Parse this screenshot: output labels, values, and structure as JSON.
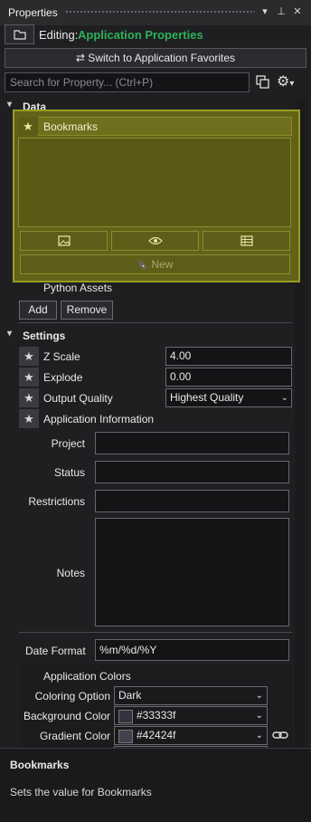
{
  "titlebar": {
    "title": "Properties",
    "pin_glyph": "⊥",
    "close_glyph": "✕",
    "dropdown_glyph": "▾"
  },
  "editing": {
    "label": "Editing:",
    "value": "Application Properties"
  },
  "switch_button": {
    "label": "⇄ Switch to Application Favorites"
  },
  "search": {
    "placeholder": "Search for Property... (Ctrl+P)"
  },
  "toolbar": {
    "gear_glyph": "⚙",
    "gear_dropdown": "▾"
  },
  "sections": {
    "data": {
      "label": "Data",
      "chevron": "▾"
    },
    "settings": {
      "label": "Settings",
      "chevron": "▾"
    }
  },
  "bookmarks": {
    "label": "Bookmarks",
    "star": "★",
    "new_label": "New",
    "new_icon": "🔖"
  },
  "python_assets": {
    "label": "Python Assets",
    "add_label": "Add",
    "remove_label": "Remove"
  },
  "settings": {
    "z_scale": {
      "label": "Z Scale",
      "value": "4.00"
    },
    "explode": {
      "label": "Explode",
      "value": "0.00"
    },
    "output_quality": {
      "label": "Output Quality",
      "value": "Highest Quality"
    },
    "app_info": {
      "label": "Application Information"
    }
  },
  "app_info_fields": {
    "project": {
      "label": "Project",
      "value": ""
    },
    "status": {
      "label": "Status",
      "value": ""
    },
    "restrictions": {
      "label": "Restrictions",
      "value": ""
    },
    "notes": {
      "label": "Notes",
      "value": ""
    },
    "date_format": {
      "label": "Date Format",
      "value": "%m/%d/%Y"
    }
  },
  "app_colors": {
    "label": "Application Colors",
    "coloring_option": {
      "label": "Coloring Option",
      "value": "Dark"
    },
    "background_color": {
      "label": "Background Color",
      "value": "#33333f",
      "swatch": "#33333f"
    },
    "gradient_color": {
      "label": "Gradient Color",
      "value": "#42424f",
      "swatch": "#42424f"
    }
  },
  "description": {
    "title": "Bookmarks",
    "text": "Sets the value for Bookmarks"
  },
  "colors": {
    "accent_green": "#2fb05a",
    "highlight_overlay": "#8c8c14"
  }
}
